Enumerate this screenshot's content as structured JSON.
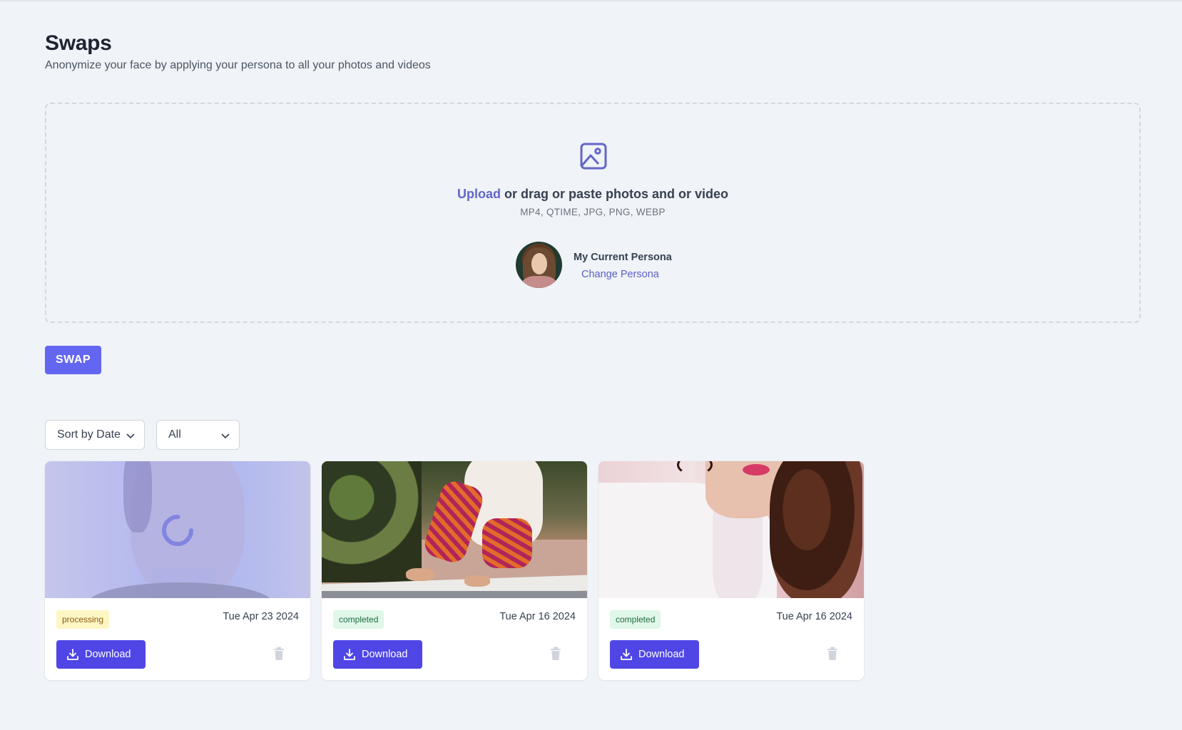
{
  "page": {
    "title": "Swaps",
    "subtitle": "Anonymize your face by applying your persona to all your photos and videos"
  },
  "dropzone": {
    "icon": "image-icon",
    "upload_link": "Upload",
    "instruction": " or drag or paste photos and or video",
    "formats": "MP4, QTIME, JPG, PNG, WEBP",
    "persona_label": "My Current Persona",
    "change_persona": "Change Persona"
  },
  "swap_button": "SWAP",
  "filters": {
    "sort": "Sort by Date",
    "type": "All"
  },
  "cards": [
    {
      "status": "processing",
      "date": "Tue Apr 23 2024",
      "download": "Download"
    },
    {
      "status": "completed",
      "date": "Tue Apr 16 2024",
      "download": "Download"
    },
    {
      "status": "completed",
      "date": "Tue Apr 16 2024",
      "download": "Download"
    }
  ],
  "colors": {
    "accent": "#6366f1",
    "download": "#4f46e5",
    "link": "#5b5fc7",
    "processing_bg": "#fef7c3",
    "completed_bg": "#e0f7e9",
    "background": "#f0f3f7"
  }
}
